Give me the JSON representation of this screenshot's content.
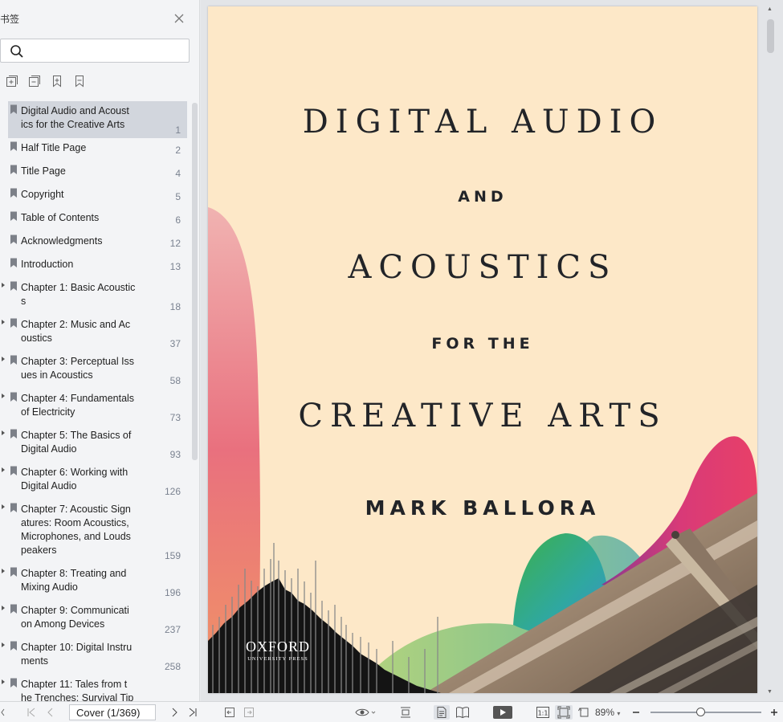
{
  "sidebar": {
    "title": "书签",
    "search": {
      "placeholder": "",
      "value": ""
    },
    "tools": [
      "add-bookmark-icon",
      "remove-bookmark-icon",
      "bookmark-icon",
      "bookmark-outline-icon"
    ],
    "bookmarks": [
      {
        "label": "Digital Audio and Acoust\nics for the Creative Arts",
        "page": "1",
        "expandable": false,
        "selected": true
      },
      {
        "label": "Half Title Page",
        "page": "2",
        "expandable": false
      },
      {
        "label": "Title Page",
        "page": "4",
        "expandable": false
      },
      {
        "label": "Copyright",
        "page": "5",
        "expandable": false
      },
      {
        "label": "Table of Contents",
        "page": "6",
        "expandable": false
      },
      {
        "label": "Acknowledgments",
        "page": "12",
        "expandable": false
      },
      {
        "label": "Introduction",
        "page": "13",
        "expandable": false
      },
      {
        "label": "Chapter 1: Basic Acoustic\ns",
        "page": "18",
        "expandable": true
      },
      {
        "label": "Chapter 2: Music and Ac\noustics",
        "page": "37",
        "expandable": true
      },
      {
        "label": "Chapter 3: Perceptual Iss\nues in Acoustics",
        "page": "58",
        "expandable": true
      },
      {
        "label": "Chapter 4: Fundamentals\nof Electricity",
        "page": "73",
        "expandable": true
      },
      {
        "label": "Chapter 5: The Basics of\nDigital Audio",
        "page": "93",
        "expandable": true
      },
      {
        "label": "Chapter 6: Working with\nDigital Audio",
        "page": "126",
        "expandable": true
      },
      {
        "label": "Chapter 7: Acoustic Sign\natures: Room Acoustics,\nMicrophones, and Louds\npeakers",
        "page": "159",
        "expandable": true
      },
      {
        "label": "Chapter 8: Treating and\nMixing Audio",
        "page": "196",
        "expandable": true
      },
      {
        "label": "Chapter 9: Communicati\non Among Devices",
        "page": "237",
        "expandable": true
      },
      {
        "label": "Chapter 10: Digital Instru\nments",
        "page": "258",
        "expandable": true
      },
      {
        "label": "Chapter 11: Tales from t\nhe Trenches: Survival Tip",
        "page": "",
        "expandable": true
      }
    ]
  },
  "cover": {
    "line1": "DIGITAL AUDIO",
    "line2": "AND",
    "line3": "ACOUSTICS",
    "line4": "FOR THE",
    "line5": "CREATIVE ARTS",
    "author": "MARK BALLORA",
    "publisher": "OXFORD",
    "publisher_sub": "UNIVERSITY PRESS",
    "background_color": "#fde8c8"
  },
  "bottombar": {
    "page_field": "Cover (1/369)",
    "zoom": "89%",
    "zoom_level": 0.45
  }
}
